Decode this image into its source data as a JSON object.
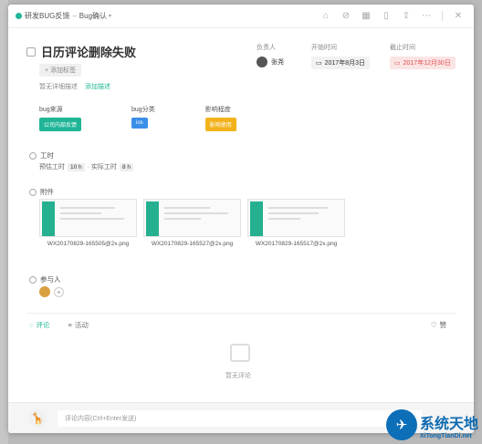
{
  "header": {
    "project": "研发BUG反馈",
    "separator": "–",
    "stage": "Bug确认",
    "icons": [
      "tag-icon",
      "attach-icon",
      "subtask-icon",
      "copy-icon",
      "share-icon",
      "more-icon",
      "close-icon"
    ]
  },
  "task": {
    "title": "日历评论删除失败",
    "add_tag": "+ 添加标签",
    "no_desc": "暂无详细描述",
    "add_desc": "添加描述"
  },
  "meta": {
    "assignee_label": "负责人",
    "assignee_name": "张尧",
    "start_label": "开始时间",
    "start_value": "2017年8月3日",
    "end_label": "截止时间",
    "end_value": "2017年12月30日"
  },
  "fields": [
    {
      "label": "bug来源",
      "value": "公司内部反馈",
      "color": "#1fb596"
    },
    {
      "label": "bug分类",
      "value": "ios",
      "color": "#3a8ee6"
    },
    {
      "label": "影响程度",
      "value": "影响使用",
      "color": "#f2b21c"
    }
  ],
  "worktime": {
    "title": "工时",
    "est_label": "预估工时",
    "est_value": "10 h",
    "sep": "· 实际工时",
    "act_value": "8 h"
  },
  "attachments": {
    "title": "附件",
    "files": [
      "WX20170829-165505@2x.png",
      "WX20170829-165527@2x.png",
      "WX20170829-165517@2x.png"
    ]
  },
  "participants": {
    "title": "参与人",
    "add": "+"
  },
  "activity": {
    "tab_comment": "评论",
    "tab_activity": "活动",
    "like": "赞",
    "empty": "暂无评论"
  },
  "comment": {
    "placeholder": "评论内容(Ctrl+Enter发送)"
  },
  "watermark": {
    "cn": "系统天地",
    "en": "XiTongTianDi.net"
  }
}
